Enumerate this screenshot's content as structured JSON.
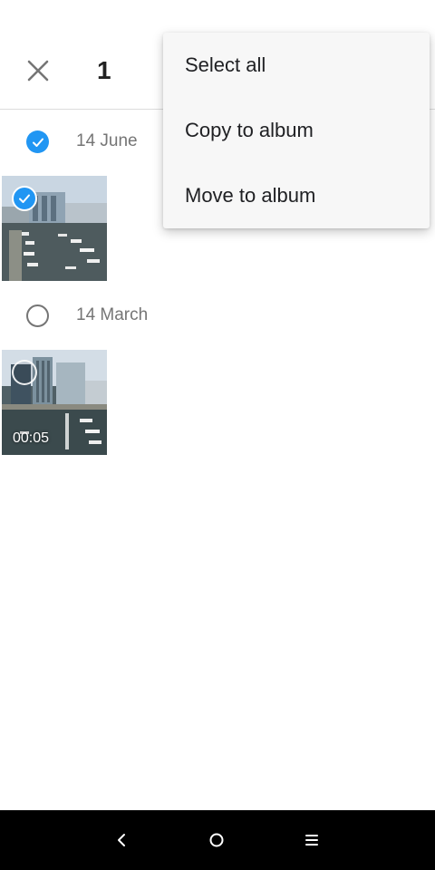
{
  "selection_bar": {
    "selected_count": "1",
    "close_icon": "close-icon"
  },
  "overflow_menu": {
    "items": [
      {
        "label": "Select all"
      },
      {
        "label": "Copy to album"
      },
      {
        "label": "Move to album"
      }
    ]
  },
  "groups": [
    {
      "date": "14 June",
      "selected": true,
      "items": [
        {
          "type": "photo",
          "selected": true,
          "thumbnail": "marina-photo"
        }
      ]
    },
    {
      "date": "14 March",
      "selected": false,
      "items": [
        {
          "type": "video",
          "selected": false,
          "duration": "00:05",
          "thumbnail": "marina-video"
        }
      ]
    }
  ],
  "navigation_bar": {
    "buttons": [
      "back-icon",
      "home-icon",
      "menu-icon"
    ]
  },
  "colors": {
    "accent": "#2196f3",
    "menu_background": "#f7f7f7",
    "nav_background": "#000000"
  }
}
